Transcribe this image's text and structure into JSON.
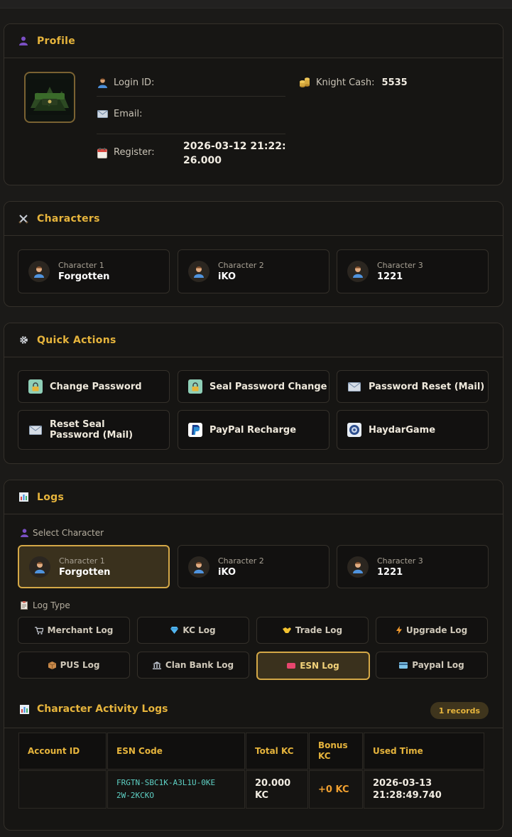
{
  "profile": {
    "title": "Profile",
    "login_label": "Login ID:",
    "login_value": "",
    "email_label": "Email:",
    "email_value": "",
    "register_label": "Register:",
    "register_value": "2026-03-12 21:22:26.000",
    "cash_label": "Knight Cash:",
    "cash_value": "5535"
  },
  "characters": {
    "title": "Characters",
    "items": [
      {
        "slot": "Character 1",
        "name": "Forgotten"
      },
      {
        "slot": "Character 2",
        "name": "iKO"
      },
      {
        "slot": "Character 3",
        "name": "1221"
      }
    ]
  },
  "quick_actions": {
    "title": "Quick Actions",
    "items": [
      {
        "label": "Change Password",
        "icon": "lock-icon"
      },
      {
        "label": "Seal Password Change",
        "icon": "lock-icon"
      },
      {
        "label": "Password Reset (Mail)",
        "icon": "mail-icon"
      },
      {
        "label": "Reset Seal Password (Mail)",
        "icon": "mail-icon"
      },
      {
        "label": "PayPal Recharge",
        "icon": "paypal-icon"
      },
      {
        "label": "HaydarGame",
        "icon": "haydargame-icon"
      }
    ]
  },
  "logs": {
    "title": "Logs",
    "select_character_label": "Select Character",
    "characters": [
      {
        "slot": "Character 1",
        "name": "Forgotten",
        "active": true
      },
      {
        "slot": "Character 2",
        "name": "iKO",
        "active": false
      },
      {
        "slot": "Character 3",
        "name": "1221",
        "active": false
      }
    ],
    "log_type_label": "Log Type",
    "log_types": [
      {
        "label": "Merchant Log",
        "icon": "cart-icon"
      },
      {
        "label": "KC Log",
        "icon": "diamond-icon"
      },
      {
        "label": "Trade Log",
        "icon": "handshake-icon"
      },
      {
        "label": "Upgrade Log",
        "icon": "lightning-icon"
      },
      {
        "label": "PUS Log",
        "icon": "package-icon"
      },
      {
        "label": "Clan Bank Log",
        "icon": "bank-icon"
      },
      {
        "label": "ESN Log",
        "icon": "ticket-icon",
        "active": true
      },
      {
        "label": "Paypal Log",
        "icon": "card-icon"
      }
    ],
    "activity_title": "Character Activity Logs",
    "records": "1 records",
    "table": {
      "headers": [
        "Account ID",
        "ESN Code",
        "Total KC",
        "Bonus KC",
        "Used Time"
      ],
      "rows": [
        {
          "account_id": "",
          "esn_code": "FRGTN-SBC1K-A3L1U-0KE2W-2KCKO",
          "total_kc": "20.000 KC",
          "bonus_kc": "+0 KC",
          "used_time": "2026-03-13 21:28:49.740"
        }
      ]
    }
  },
  "colors": {
    "accent": "#e6b43c",
    "background": "#1b1a18",
    "card": "#161513",
    "code": "#5ed0c4",
    "bonus": "#f0a030"
  }
}
